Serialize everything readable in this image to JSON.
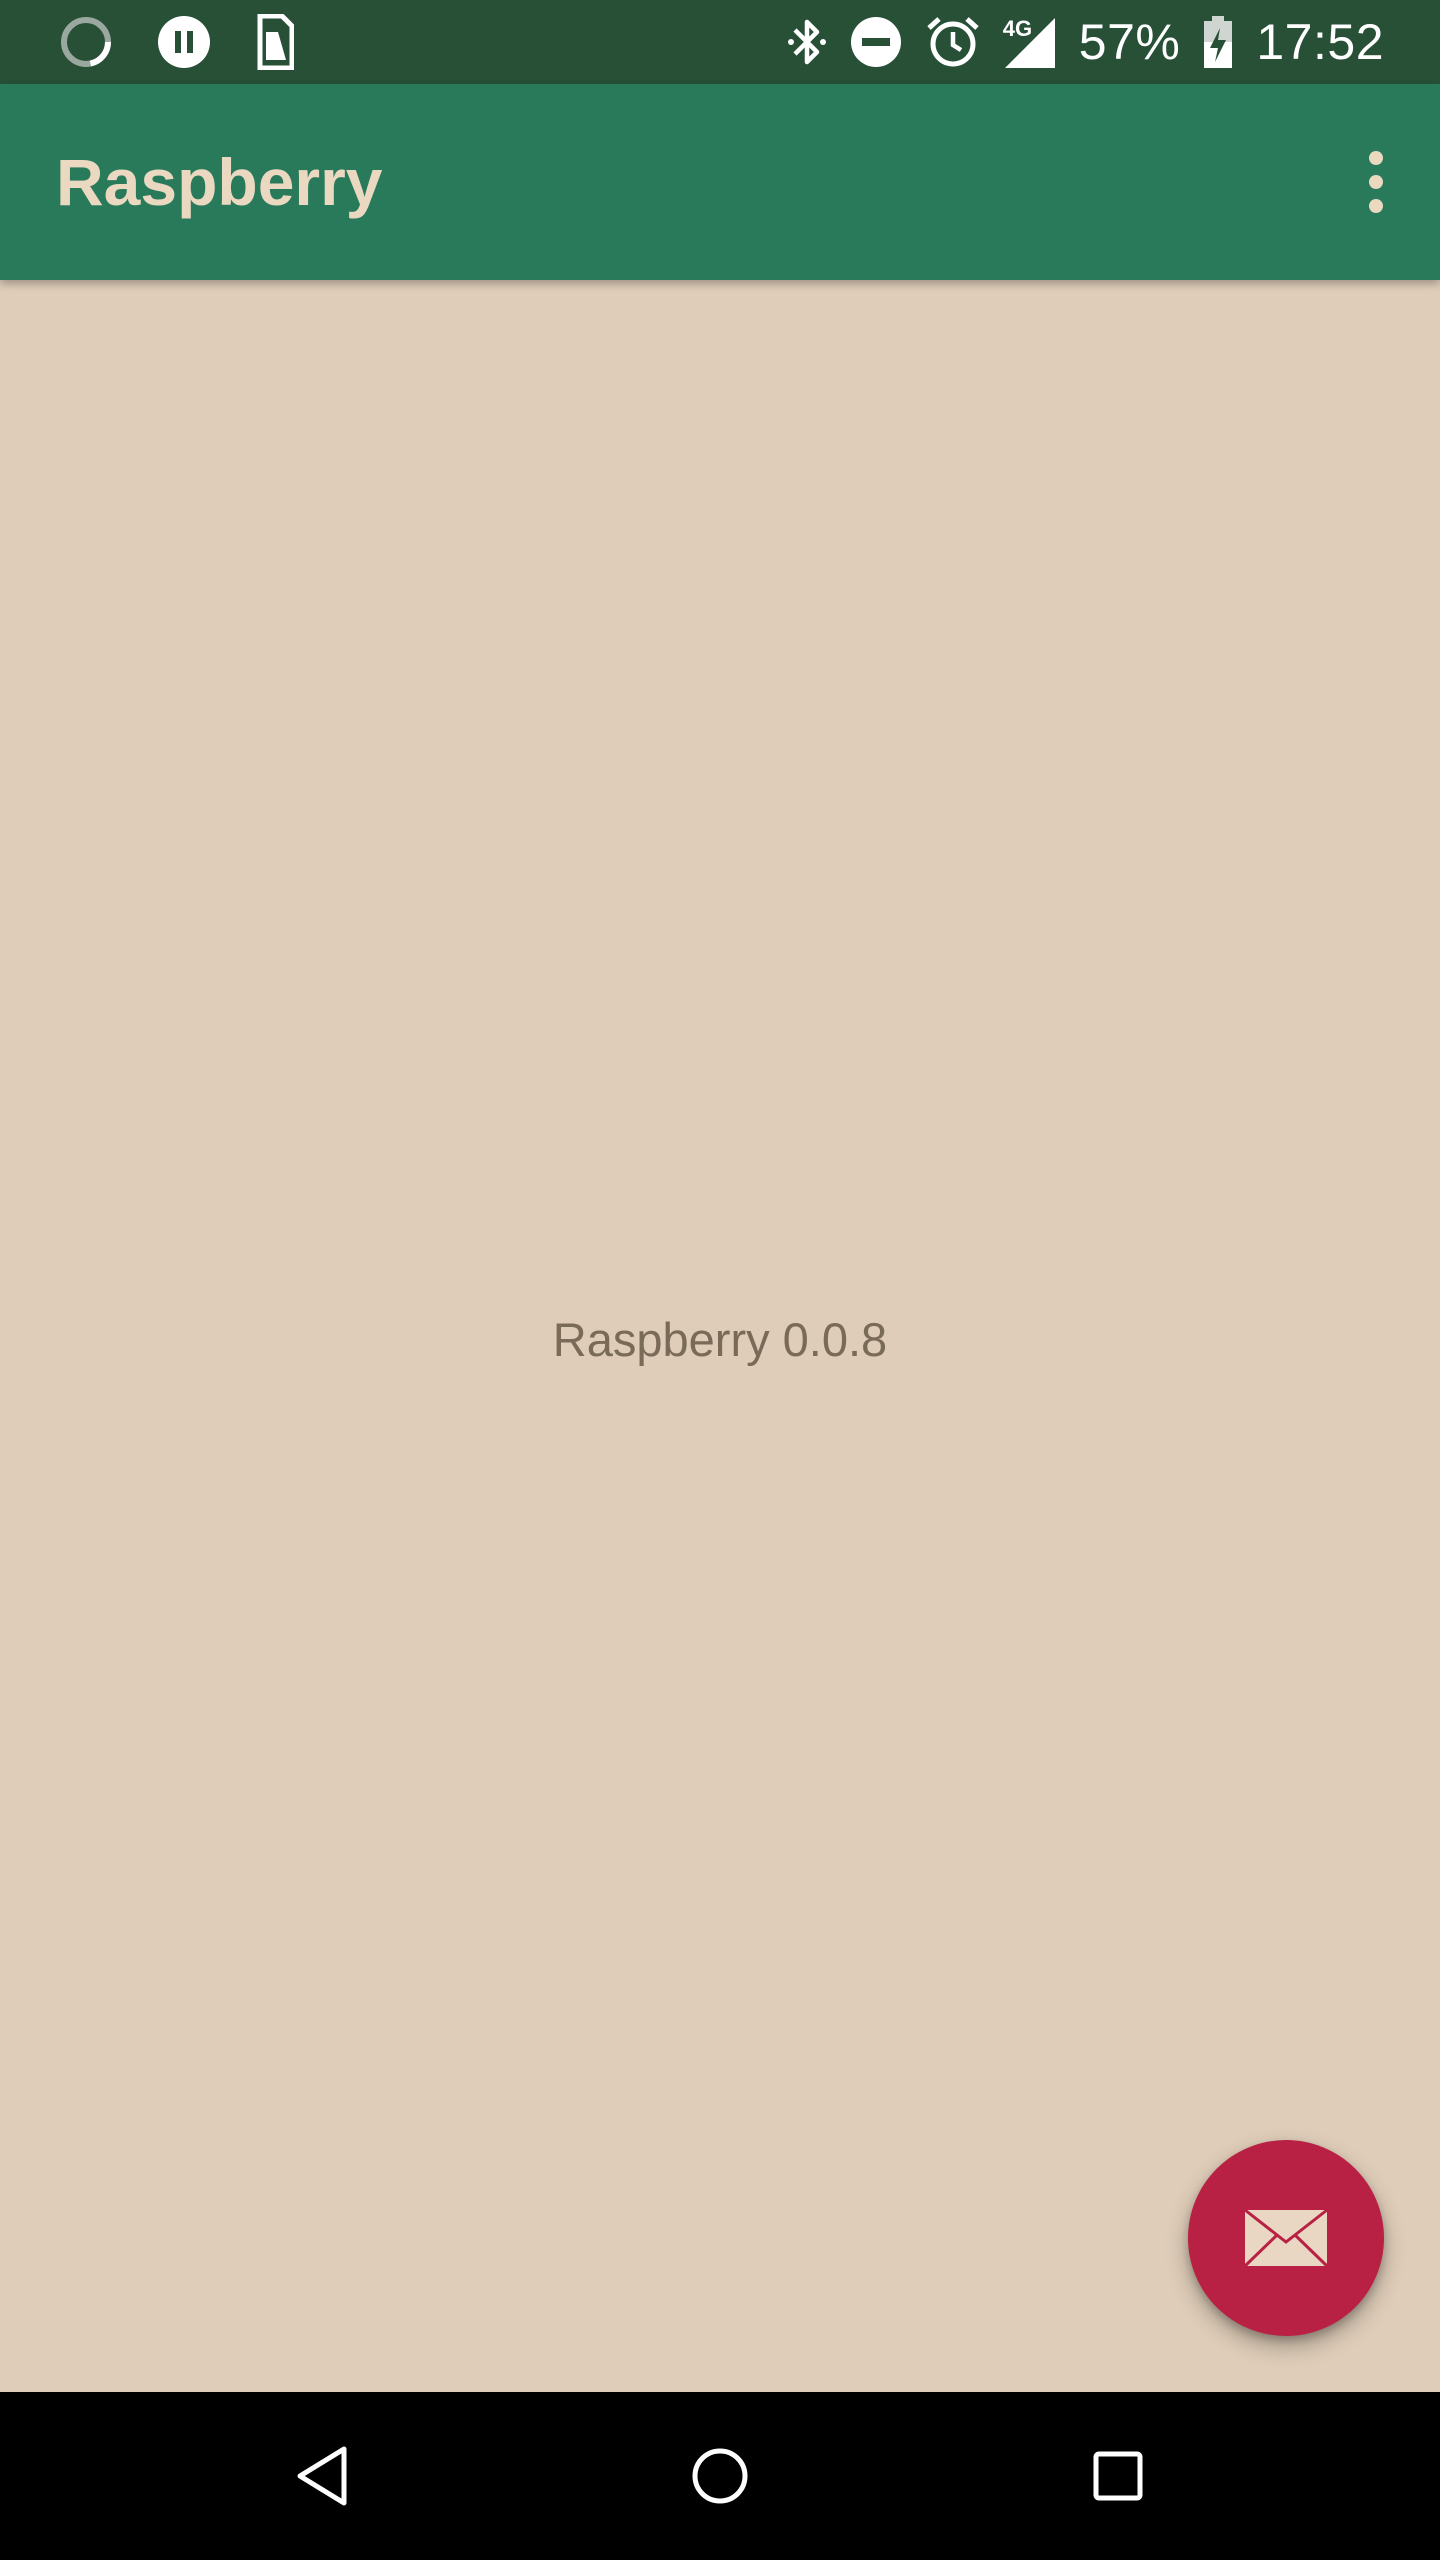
{
  "status_bar": {
    "battery_percent": "57%",
    "time": "17:52",
    "network_type": "4G",
    "left_icons": [
      "loading-circle-icon",
      "pause-circle-icon",
      "sim-card-icon"
    ],
    "right_icons": [
      "bluetooth-icon",
      "do-not-disturb-icon",
      "alarm-icon",
      "cell-signal-icon",
      "battery-charging-icon"
    ],
    "background_color": "#275037"
  },
  "app_bar": {
    "title": "Raspberry",
    "overflow_icon": "more-vert-icon",
    "background_color": "#287A5B",
    "title_color": "#EBD8C0"
  },
  "main": {
    "version_text": "Raspberry 0.0.8",
    "background_color": "#DFCDB9"
  },
  "fab": {
    "icon": "mail-icon",
    "color": "#B82143"
  },
  "nav_bar": {
    "buttons": [
      "back-icon",
      "home-icon",
      "recents-icon"
    ]
  }
}
